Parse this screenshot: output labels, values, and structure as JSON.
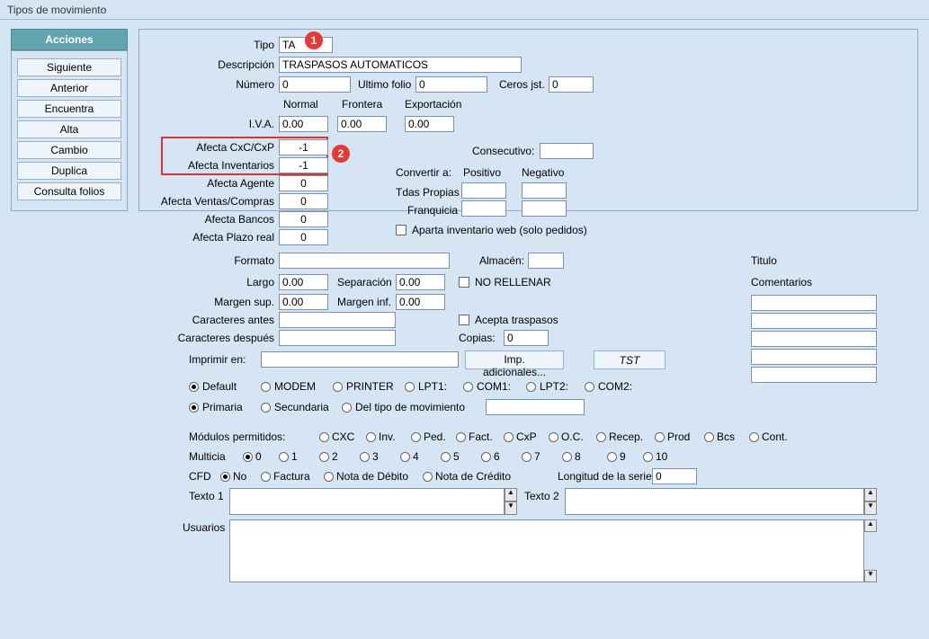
{
  "window": {
    "title": "Tipos de movimiento"
  },
  "sidebar": {
    "header": "Acciones",
    "items": [
      {
        "label": "Siguiente"
      },
      {
        "label": "Anterior"
      },
      {
        "label": "Encuentra"
      },
      {
        "label": "Alta"
      },
      {
        "label": "Cambio"
      },
      {
        "label": "Duplica"
      },
      {
        "label": "Consulta folios"
      }
    ]
  },
  "form": {
    "tipo_label": "Tipo",
    "tipo_value": "TA",
    "descripcion_label": "Descripción",
    "descripcion_value": "TRASPASOS AUTOMATICOS",
    "numero_label": "Número",
    "numero_value": "0",
    "ultimo_folio_label": "Ultimo folio",
    "ultimo_folio_value": "0",
    "ceros_jst_label": "Ceros jst.",
    "ceros_jst_value": "0",
    "normal_label": "Normal",
    "frontera_label": "Frontera",
    "exportacion_label": "Exportación",
    "iva_label": "I.V.A.",
    "iva_normal": "0.00",
    "iva_frontera": "0.00",
    "iva_export": "0.00",
    "afecta_cxc_label": "Afecta  CxC/CxP",
    "afecta_cxc_value": "-1",
    "afecta_inv_label": "Afecta  Inventarios",
    "afecta_inv_value": "-1",
    "afecta_agente_label": "Afecta  Agente",
    "afecta_agente_value": "0",
    "afecta_ventas_label": "Afecta  Ventas/Compras",
    "afecta_ventas_value": "0",
    "afecta_bancos_label": "Afecta  Bancos",
    "afecta_bancos_value": "0",
    "afecta_plazo_label": "Afecta  Plazo real",
    "afecta_plazo_value": "0",
    "consecutivo_label": "Consecutivo:",
    "consecutivo_value": "",
    "convertir_label": "Convertir a:",
    "positivo_label": "Positivo",
    "negativo_label": "Negativo",
    "tdas_propias_label": "Tdas Propias",
    "tdas_propias_val": "",
    "tdas_propias_val2": "",
    "franquicia_label": "Franquicia",
    "franquicia_val": "",
    "franquicia_val2": "",
    "aparta_inv_label": "Aparta inventario web (solo pedidos)",
    "formato_label": "Formato",
    "formato_value": "",
    "almacen_label": "Almacén:",
    "almacen_value": "",
    "titulo_label": "Titulo",
    "largo_label": "Largo",
    "largo_value": "0.00",
    "separacion_label": "Separación",
    "separacion_value": "0.00",
    "no_rellenar_label": "NO RELLENAR",
    "comentarios_label": "Comentarios",
    "margen_sup_label": "Margen sup.",
    "margen_sup_value": "0.00",
    "margen_inf_label": "Margen inf.",
    "margen_inf_value": "0.00",
    "caracteres_antes_label": "Caracteres antes",
    "caracteres_antes_value": "",
    "acepta_traspasos_label": "Acepta traspasos",
    "caracteres_despues_label": "Caracteres después",
    "caracteres_despues_value": "",
    "copias_label": "Copias:",
    "copias_value": "0",
    "imprimir_en_label": "Imprimir en:",
    "imprimir_en_value": "",
    "imp_adicionales_btn": "Imp. adicionales...",
    "tst_btn": "TST",
    "printers": {
      "default": "Default",
      "modem": "MODEM",
      "printer": "PRINTER",
      "lpt1": "LPT1:",
      "com1": "COM1:",
      "lpt2": "LPT2:",
      "com2": "COM2:"
    },
    "printer_mode": {
      "primaria": "Primaria",
      "secundaria": "Secundaria",
      "del_tipo": "Del tipo de movimiento"
    },
    "del_tipo_value": "",
    "modulos_label": "Módulos permitidos:",
    "modulos": {
      "cxc": "CXC",
      "inv": "Inv.",
      "ped": "Ped.",
      "fact": "Fact.",
      "cxp": "CxP",
      "oc": "O.C.",
      "recep": "Recep.",
      "prod": "Prod",
      "bcs": "Bcs",
      "cont": "Cont."
    },
    "multicia_label": "Multicia",
    "multicia": {
      "m0": "0",
      "m1": "1",
      "m2": "2",
      "m3": "3",
      "m4": "4",
      "m5": "5",
      "m6": "6",
      "m7": "7",
      "m8": "8",
      "m9": "9",
      "m10": "10"
    },
    "cfd_label": "CFD",
    "cfd": {
      "no": "No",
      "factura": "Factura",
      "nota_debito": "Nota de Débito",
      "nota_credito": "Nota de Crédito"
    },
    "longitud_serie_label": "Longitud de la serie",
    "longitud_serie_value": "0",
    "texto1_label": "Texto 1",
    "texto1_value": "",
    "texto2_label": "Texto 2",
    "texto2_value": "",
    "usuarios_label": "Usuarios",
    "usuarios_value": ""
  },
  "markers": {
    "m1": "1",
    "m2": "2"
  }
}
